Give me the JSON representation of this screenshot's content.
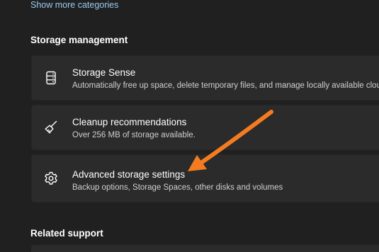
{
  "top_link": {
    "label": "Show more categories"
  },
  "storage_management": {
    "heading": "Storage management",
    "items": [
      {
        "icon": "storage-drive-icon",
        "title": "Storage Sense",
        "subtitle": "Automatically free up space, delete temporary files, and manage locally available cloud content"
      },
      {
        "icon": "broom-icon",
        "title": "Cleanup recommendations",
        "subtitle": "Over 256 MB of storage available."
      },
      {
        "icon": "gear-icon",
        "title": "Advanced storage settings",
        "subtitle": "Backup options, Storage Spaces, other disks and volumes"
      }
    ]
  },
  "related_support": {
    "heading": "Related support"
  },
  "colors": {
    "background": "#202020",
    "card": "#2b2b2b",
    "link": "#99c9ef",
    "annotation_arrow": "#f47c20"
  }
}
